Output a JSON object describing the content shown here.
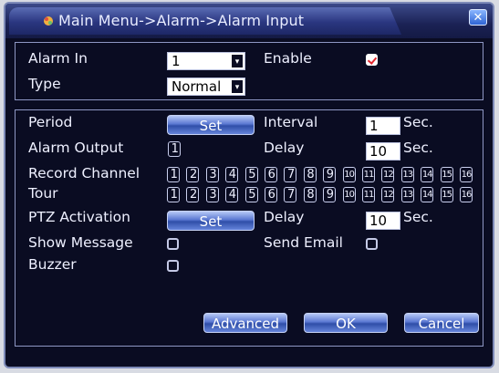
{
  "window": {
    "title": "Main Menu->Alarm->Alarm Input",
    "close_symbol": "✕"
  },
  "top": {
    "alarm_in_label": "Alarm In",
    "alarm_in_value": "1",
    "enable_label": "Enable",
    "enable_checked": true,
    "type_label": "Type",
    "type_value": "Normal",
    "dropdown_arrow": "▾"
  },
  "settings": {
    "period_label": "Period",
    "period_button": "Set",
    "interval_label": "Interval",
    "interval_value": "1",
    "interval_unit": "Sec.",
    "alarm_output_label": "Alarm Output",
    "alarm_output_channel": "1",
    "delay_label": "Delay",
    "delay_value": "10",
    "delay_unit": "Sec.",
    "record_channel_label": "Record Channel",
    "tour_label": "Tour",
    "channels": [
      "1",
      "2",
      "3",
      "4",
      "5",
      "6",
      "7",
      "8",
      "9",
      "10",
      "11",
      "12",
      "13",
      "14",
      "15",
      "16"
    ],
    "ptz_label": "PTZ Activation",
    "ptz_button": "Set",
    "ptz_delay_label": "Delay",
    "ptz_delay_value": "10",
    "ptz_delay_unit": "Sec.",
    "show_message_label": "Show Message",
    "show_message_checked": false,
    "send_email_label": "Send Email",
    "send_email_checked": false,
    "buzzer_label": "Buzzer",
    "buzzer_checked": false
  },
  "footer": {
    "advanced_button": "Advanced",
    "ok_button": "OK",
    "cancel_button": "Cancel"
  }
}
